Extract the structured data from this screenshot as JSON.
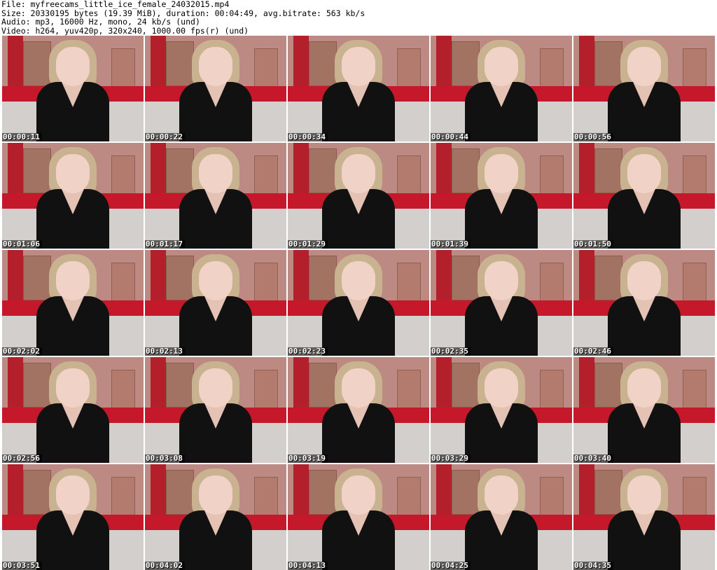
{
  "header": {
    "file_line": "File: myfreecams_little_ice_female_24032015.mp4",
    "size_line": "Size: 20330195 bytes (19.39 MiB), duration: 00:04:49, avg.bitrate: 563 kb/s",
    "audio_line": "Audio: mp3, 16000 Hz, mono, 24 kb/s (und)",
    "video_line": "Video: h264, yuv420p, 320x240, 1000.00 fps(r) (und)"
  },
  "thumbnails": [
    {
      "timestamp": "00:00:11"
    },
    {
      "timestamp": "00:00:22"
    },
    {
      "timestamp": "00:00:34"
    },
    {
      "timestamp": "00:00:44"
    },
    {
      "timestamp": "00:00:56"
    },
    {
      "timestamp": "00:01:06"
    },
    {
      "timestamp": "00:01:17"
    },
    {
      "timestamp": "00:01:29"
    },
    {
      "timestamp": "00:01:39"
    },
    {
      "timestamp": "00:01:50"
    },
    {
      "timestamp": "00:02:02"
    },
    {
      "timestamp": "00:02:13"
    },
    {
      "timestamp": "00:02:23"
    },
    {
      "timestamp": "00:02:35"
    },
    {
      "timestamp": "00:02:46"
    },
    {
      "timestamp": "00:02:56"
    },
    {
      "timestamp": "00:03:08"
    },
    {
      "timestamp": "00:03:19"
    },
    {
      "timestamp": "00:03:29"
    },
    {
      "timestamp": "00:03:40"
    },
    {
      "timestamp": "00:03:51"
    },
    {
      "timestamp": "00:04:02"
    },
    {
      "timestamp": "00:04:13"
    },
    {
      "timestamp": "00:04:25"
    },
    {
      "timestamp": "00:04:35"
    }
  ]
}
